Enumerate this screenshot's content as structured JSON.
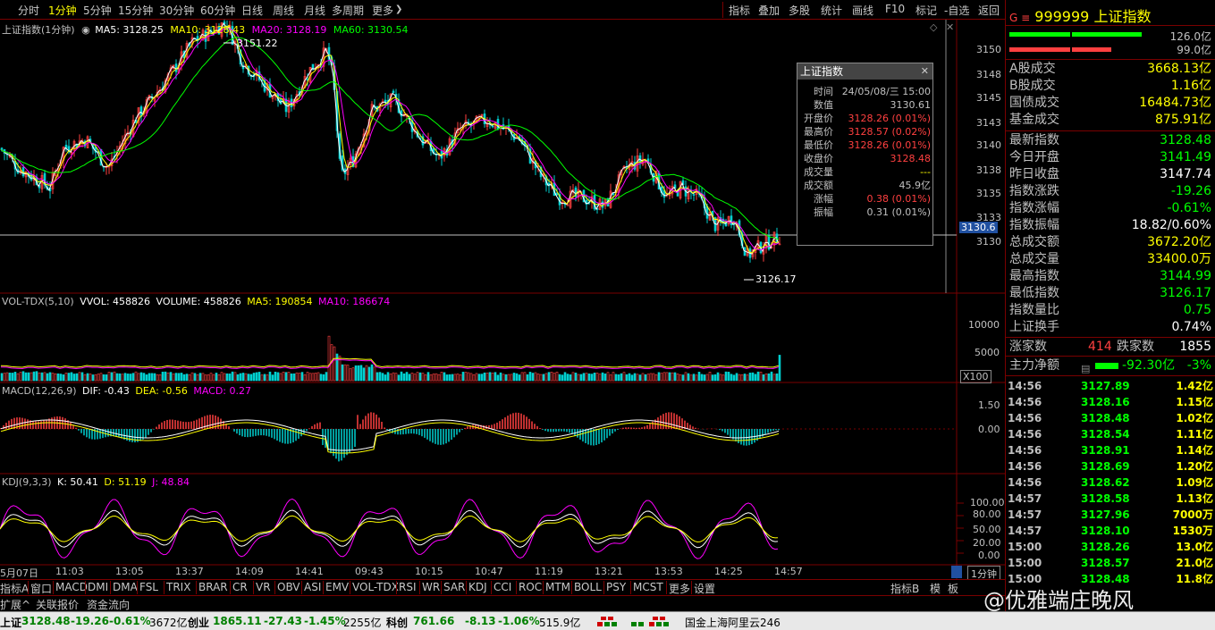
{
  "toolbar": {
    "periods": [
      "分时",
      "1分钟",
      "5分钟",
      "15分钟",
      "30分钟",
      "60分钟",
      "日线",
      "周线",
      "月线",
      "多周期",
      "更多"
    ],
    "active_period": "1分钟",
    "more_chevron": "❯",
    "right": [
      "指标",
      "叠加",
      "多股",
      "统计",
      "画线",
      "F10",
      "标记",
      "-自选",
      "返回"
    ]
  },
  "main_legend": {
    "title": "上证指数(1分钟)",
    "ma5": "MA5: 3128.25",
    "ma10": "MA10: 3128.43",
    "ma20": "MA20: 3128.19",
    "ma60": "MA60: 3130.54"
  },
  "main_axis": [
    "3150",
    "3148",
    "3145",
    "3143",
    "3140",
    "3138",
    "3135",
    "3133",
    "3130"
  ],
  "crosshair_value": "3130.6",
  "annotations": {
    "high": "3151.22",
    "low": "3126.17"
  },
  "vol_legend": {
    "title": "VOL-TDX(5,10)",
    "vvol": "VVOL: 458826",
    "volume": "VOLUME: 458826",
    "ma5": "MA5: 190854",
    "ma10": "MA10: 186674"
  },
  "vol_axis": [
    "10000",
    "5000"
  ],
  "vol_unit": "X100",
  "macd_legend": {
    "title": "MACD(12,26,9)",
    "dif": "DIF: -0.43",
    "dea": "DEA: -0.56",
    "macd": "MACD: 0.27"
  },
  "macd_axis": [
    "1.50",
    "0.00"
  ],
  "kdj_legend": {
    "title": "KDJ(9,3,3)",
    "k": "K: 50.41",
    "d": "D: 51.19",
    "j": "J: 48.84"
  },
  "kdj_axis": [
    "100.00",
    "80.00",
    "50.00",
    "20.00",
    "0.00"
  ],
  "time_axis": [
    "5月07日",
    "11:03",
    "13:05",
    "13:37",
    "14:09",
    "14:41",
    "09:43",
    "10:15",
    "10:47",
    "11:19",
    "13:21",
    "13:53",
    "14:25",
    "14:57"
  ],
  "period_badge": "1分钟",
  "popup": {
    "title": "上证指数",
    "rows": [
      {
        "k": "时间",
        "v": "24/05/08/三 15:00",
        "c": "#c0c0c0"
      },
      {
        "k": "数值",
        "v": "3130.61",
        "c": "#c0c0c0"
      },
      {
        "k": "开盘价",
        "v": "3128.26 (0.01%)",
        "c": "#ff4040"
      },
      {
        "k": "最高价",
        "v": "3128.57 (0.02%)",
        "c": "#ff4040"
      },
      {
        "k": "最低价",
        "v": "3128.26 (0.01%)",
        "c": "#ff4040"
      },
      {
        "k": "收盘价",
        "v": "3128.48",
        "c": "#ff4040"
      },
      {
        "k": "成交量",
        "v": "---",
        "c": "#ffff00"
      },
      {
        "k": "成交额",
        "v": "45.9亿",
        "c": "#c0c0c0"
      },
      {
        "k": "涨幅",
        "v": "0.38 (0.01%)",
        "c": "#ff4040"
      },
      {
        "k": "振幅",
        "v": "0.31 (0.01%)",
        "c": "#c0c0c0"
      }
    ]
  },
  "quote": {
    "code_prefix": "G ≡",
    "code": "999999",
    "name": "上证指数",
    "bar_top": "126.0亿",
    "bar_bottom": "99.0亿",
    "block1": [
      {
        "k": "A股成交",
        "v": "3668.13亿",
        "c": "#ffff00"
      },
      {
        "k": "B股成交",
        "v": "1.16亿",
        "c": "#ffff00"
      },
      {
        "k": "国债成交",
        "v": "16484.73亿",
        "c": "#ffff00"
      },
      {
        "k": "基金成交",
        "v": "875.91亿",
        "c": "#ffff00"
      }
    ],
    "block2": [
      {
        "k": "最新指数",
        "v": "3128.48",
        "c": "#00ff00"
      },
      {
        "k": "今日开盘",
        "v": "3141.49",
        "c": "#00ff00"
      },
      {
        "k": "昨日收盘",
        "v": "3147.74",
        "c": "#ffffff"
      },
      {
        "k": "指数涨跌",
        "v": "-19.26",
        "c": "#00ff00"
      },
      {
        "k": "指数涨幅",
        "v": "-0.61%",
        "c": "#00ff00"
      },
      {
        "k": "指数振幅",
        "v": "18.82/0.60%",
        "c": "#ffffff"
      },
      {
        "k": "总成交额",
        "v": "3672.20亿",
        "c": "#ffff00"
      },
      {
        "k": "总成交量",
        "v": "33400.0万",
        "c": "#ffff00"
      },
      {
        "k": "最高指数",
        "v": "3144.99",
        "c": "#00ff00"
      },
      {
        "k": "最低指数",
        "v": "3126.17",
        "c": "#00ff00"
      },
      {
        "k": "指数量比",
        "v": "0.75",
        "c": "#00ff00"
      },
      {
        "k": "上证换手",
        "v": "0.74%",
        "c": "#ffffff"
      }
    ],
    "up_label": "涨家数",
    "up_value": "414",
    "down_label": "跌家数",
    "down_value": "1855",
    "flow_label": "主力净额",
    "flow_value": "-92.30亿",
    "flow_pct": "-3%"
  },
  "ticks": [
    {
      "t": "14:56",
      "p": "3127.89",
      "a": "1.42亿"
    },
    {
      "t": "14:56",
      "p": "3128.16",
      "a": "1.15亿"
    },
    {
      "t": "14:56",
      "p": "3128.48",
      "a": "1.02亿"
    },
    {
      "t": "14:56",
      "p": "3128.54",
      "a": "1.11亿"
    },
    {
      "t": "14:56",
      "p": "3128.91",
      "a": "1.14亿"
    },
    {
      "t": "14:56",
      "p": "3128.69",
      "a": "1.20亿"
    },
    {
      "t": "14:56",
      "p": "3128.62",
      "a": "1.09亿"
    },
    {
      "t": "14:57",
      "p": "3128.58",
      "a": "1.13亿"
    },
    {
      "t": "14:57",
      "p": "3127.96",
      "a": "7000万"
    },
    {
      "t": "14:57",
      "p": "3128.10",
      "a": "1530万"
    },
    {
      "t": "15:00",
      "p": "3128.26",
      "a": "13.0亿"
    },
    {
      "t": "15:00",
      "p": "3128.57",
      "a": "21.0亿"
    },
    {
      "t": "15:00",
      "p": "3128.48",
      "a": "11.8亿"
    }
  ],
  "indicator_tabs": [
    "指标A",
    "窗口",
    "MACD",
    "DMI",
    "DMA",
    "FSL",
    "TRIX",
    "BRAR",
    "CR",
    "VR",
    "OBV",
    "ASI",
    "EMV",
    "VOL-TDX",
    "RSI",
    "WR",
    "SAR",
    "KDJ",
    "CCI",
    "ROC",
    "MTM",
    "BOLL",
    "PSY",
    "MCST",
    "更多",
    "设置"
  ],
  "tabs_right": [
    "指标B",
    "模",
    "板"
  ],
  "bottom_tabs": [
    "扩展^",
    "关联报价",
    "资金流向"
  ],
  "status": {
    "sh_label": "上证",
    "sh_value": "3128.48",
    "sh_chg": "-19.26",
    "sh_pct": "-0.61%",
    "sh_amt": "3672亿",
    "cy_label": "创业",
    "cy_value": "1865.11",
    "cy_chg": "-27.43",
    "cy_pct": "-1.45%",
    "cy_amt": "2255亿",
    "kc_label": "科创",
    "kc_value": "761.66",
    "kc_chg": "-8.13",
    "kc_pct": "-1.06%",
    "kc_amt": "515.9亿",
    "server": "国金上海阿里云246"
  },
  "watermark": "@优雅端庄晚风",
  "colors": {
    "up": "#ff4040",
    "down": "#00ff00",
    "ma5": "#ffffff",
    "ma10": "#ffff00",
    "ma20": "#ff00ff",
    "ma60": "#00ff00",
    "kdj_k": "#ffffff",
    "kdj_d": "#ffff00",
    "kdj_j": "#ff00ff",
    "border": "#7a0000"
  }
}
